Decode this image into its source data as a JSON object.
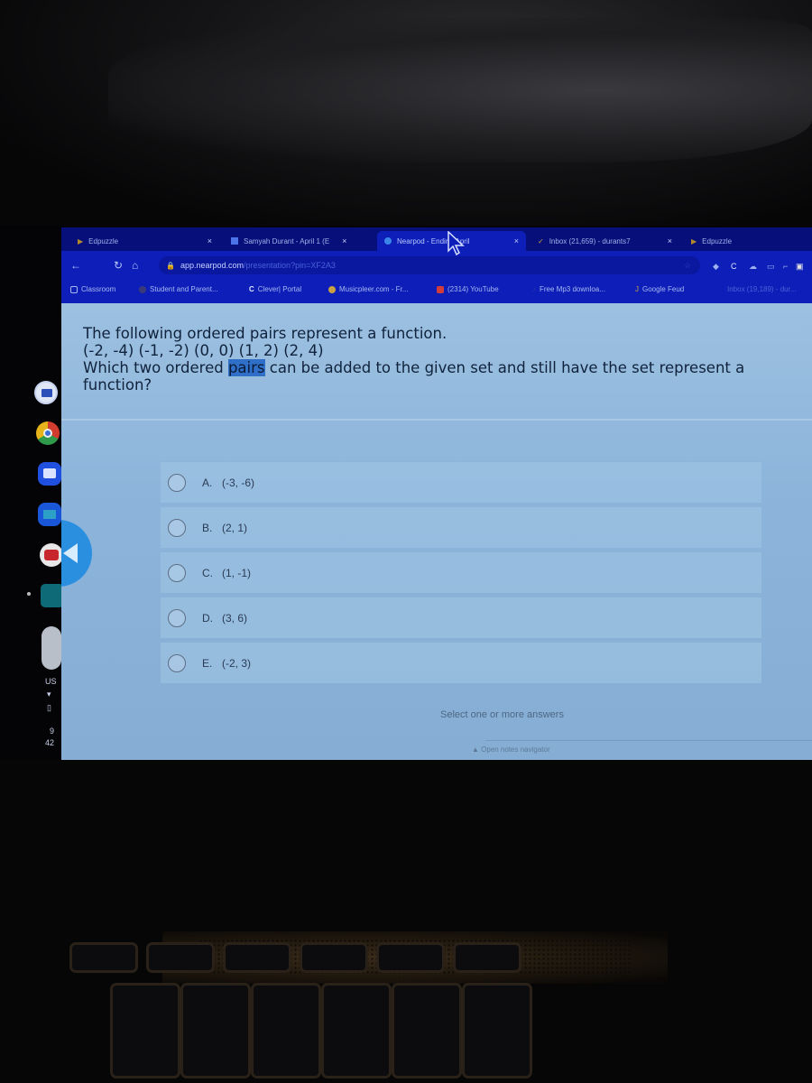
{
  "browser": {
    "tabs": [
      {
        "title": "Edpuzzle",
        "icon": "edpuzzle-icon",
        "active": false
      },
      {
        "title": "Samyah Durant - April 1 (E",
        "icon": "docs-icon",
        "active": false
      },
      {
        "title": "Nearpod - Ending April",
        "icon": "nearpod-icon",
        "active": true
      },
      {
        "title": "Inbox (21,659) - durants7",
        "icon": "gmail-icon",
        "active": false
      },
      {
        "title": "Edpuzzle",
        "icon": "edpuzzle-icon",
        "active": false
      }
    ],
    "close_glyph": "×",
    "url_host": "app.nearpod.com",
    "url_path": "/presentation?pin=XF2A3",
    "bookmarks": [
      {
        "label": "Classroom",
        "icon": "classroom-icon"
      },
      {
        "label": "Student and Parent...",
        "icon": "ss-icon"
      },
      {
        "label": "Clever| Portal",
        "icon": "clever-icon"
      },
      {
        "label": "Musicpleer.com - Fr...",
        "icon": "music-icon"
      },
      {
        "label": "(2314) YouTube",
        "icon": "youtube-icon"
      },
      {
        "label": "Free Mp3 downloa...",
        "icon": "music-note-icon"
      },
      {
        "label": "Google Feud",
        "icon": "feud-icon"
      },
      {
        "label": "Inbox (19,189) - dur...",
        "icon": "gmail-icon"
      }
    ]
  },
  "question": {
    "line1": "The following ordered pairs represent a function.",
    "pairs": "(-2, -4) (-1, -2) (0, 0) (1, 2) (2, 4)",
    "line3_before": "Which two ordered ",
    "line3_highlight": "pairs",
    "line3_after": " can be added to the given set and still have the set represent a",
    "line4": "function?"
  },
  "options": [
    {
      "letter": "A.",
      "value": "(-3, -6)",
      "selected": false
    },
    {
      "letter": "B.",
      "value": "(2, 1)",
      "selected": false
    },
    {
      "letter": "C.",
      "value": "(1, -1)",
      "selected": false
    },
    {
      "letter": "D.",
      "value": "(3, 6)",
      "selected": false
    },
    {
      "letter": "E.",
      "value": "(-2, 3)",
      "selected": false
    }
  ],
  "hint": "Select one or more answers",
  "notes_link": "▲ Open notes navigator",
  "shelf": {
    "apps": [
      "classroom-app",
      "chrome-app",
      "camera-app",
      "files-app",
      "youtube-app",
      "calculator-app"
    ],
    "locale": "US",
    "time_hour": "9",
    "time_minute": "42"
  },
  "colors": {
    "chrome_bg": "#0d1fb8",
    "page_bg": "#8fb6d8",
    "accent": "#2b8fe0",
    "highlight": "#2f6fc7"
  }
}
